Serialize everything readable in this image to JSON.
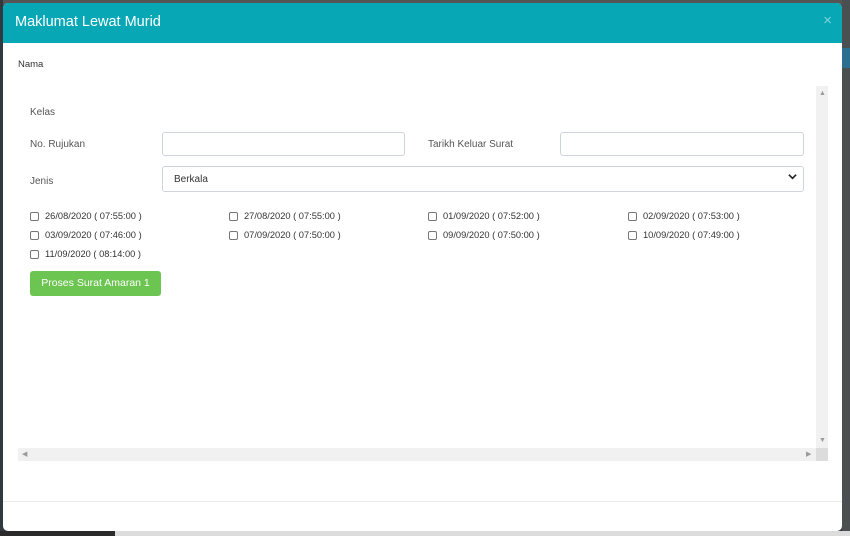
{
  "modal": {
    "title": "Maklumat Lewat Murid",
    "close_symbol": "×"
  },
  "fields": {
    "nama_label": "Nama",
    "kelas_label": "Kelas",
    "no_rujukan_label": "No. Rujukan",
    "no_rujukan_value": "",
    "tarikh_label": "Tarikh Keluar Surat",
    "tarikh_value": "",
    "jenis_label": "Jenis",
    "jenis_value": "Berkala"
  },
  "dates": [
    "26/08/2020 ( 07:55:00 )",
    "27/08/2020 ( 07:55:00 )",
    "01/09/2020 ( 07:52:00 )",
    "02/09/2020 ( 07:53:00 )",
    "03/09/2020 ( 07:46:00 )",
    "07/09/2020 ( 07:50:00 )",
    "09/09/2020 ( 07:50:00 )",
    "10/09/2020 ( 07:49:00 )",
    "11/09/2020 ( 08:14:00 )"
  ],
  "actions": {
    "proses_label": "Proses Surat Amaran 1"
  },
  "colors": {
    "header": "#08a7b6",
    "button": "#6cc551"
  },
  "icons": {
    "close": "close-icon",
    "dropdown": "chevron-down-icon",
    "scroll_up": "scroll-up-arrow",
    "scroll_down": "scroll-down-arrow",
    "scroll_left": "scroll-left-arrow",
    "scroll_right": "scroll-right-arrow"
  }
}
